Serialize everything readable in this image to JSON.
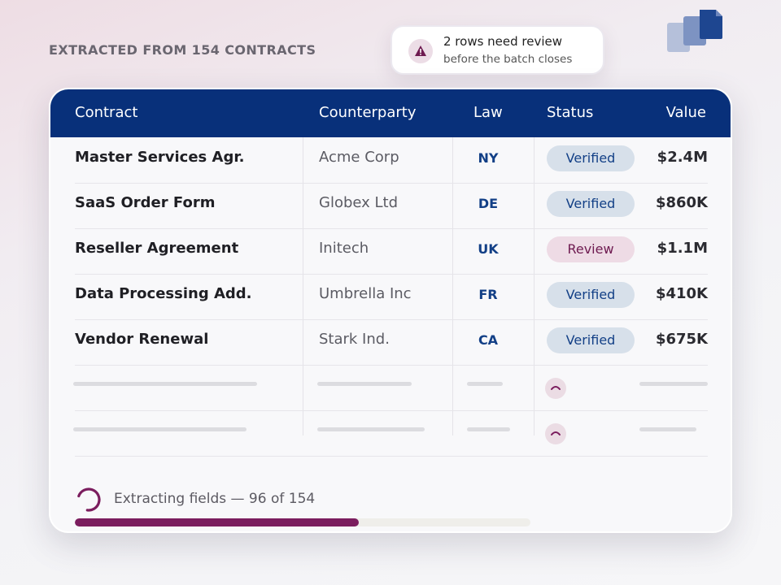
{
  "heading": "EXTRACTED FROM 154 CONTRACTS",
  "toast": {
    "title": "2 rows need review",
    "subtitle": "before the batch closes",
    "icon": "warning-icon"
  },
  "logo_icon": "stacked-documents-icon",
  "table": {
    "columns": [
      "Contract",
      "Counterparty",
      "Law",
      "Status",
      "Value"
    ],
    "rows": [
      {
        "contract": "Master Services Agr.",
        "counterparty": "Acme Corp",
        "law": "NY",
        "status": "Verified",
        "value": "$2.4M"
      },
      {
        "contract": "SaaS Order Form",
        "counterparty": "Globex Ltd",
        "law": "DE",
        "status": "Verified",
        "value": "$860K"
      },
      {
        "contract": "Reseller Agreement",
        "counterparty": "Initech",
        "law": "UK",
        "status": "Review",
        "value": "$1.1M"
      },
      {
        "contract": "Data Processing Add.",
        "counterparty": "Umbrella Inc",
        "law": "FR",
        "status": "Verified",
        "value": "$410K"
      },
      {
        "contract": "Vendor Renewal",
        "counterparty": "Stark Ind.",
        "law": "CA",
        "status": "Verified",
        "value": "$675K"
      }
    ]
  },
  "progress": {
    "label": "Extracting fields — 96 of 154",
    "done": 96,
    "total": 154,
    "fraction": 0.623
  },
  "colors": {
    "header": "#08307a",
    "accent": "#7b1d5e",
    "verified_bg": "#d7e0ea",
    "review_bg": "#eedbe5"
  }
}
